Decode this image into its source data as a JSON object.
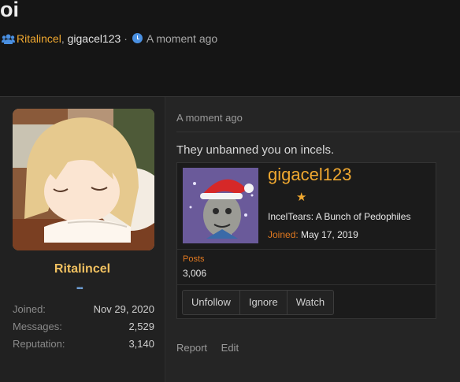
{
  "thread": {
    "title": "oi",
    "participants": [
      "Ritalincel",
      "gigacel123"
    ],
    "separator": "·",
    "time": "A moment ago"
  },
  "post": {
    "author": {
      "name": "Ritalincel",
      "stats": [
        {
          "label": "Joined:",
          "value": "Nov 29, 2020"
        },
        {
          "label": "Messages:",
          "value": "2,529"
        },
        {
          "label": "Reputation:",
          "value": "3,140"
        }
      ]
    },
    "time": "A moment ago",
    "text": "They unbanned you on incels.",
    "actions": [
      "Report",
      "Edit"
    ]
  },
  "member_card": {
    "name": "gigacel123",
    "user_title": "IncelTears: A Bunch of Pedophiles",
    "joined_label": "Joined:",
    "joined_value": "May 17, 2019",
    "posts_label": "Posts",
    "posts_value": "3,006",
    "buttons": [
      "Unfollow",
      "Ignore",
      "Watch"
    ]
  },
  "colors": {
    "accent_orange": "#f0a830",
    "username_gold": "#f0c060",
    "label_orange": "#e07820",
    "clock_blue": "#4a90e2"
  },
  "icons": [
    "users-icon",
    "clock-icon",
    "star-icon",
    "rank-icon"
  ]
}
